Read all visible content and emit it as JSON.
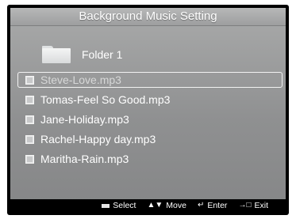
{
  "dialog": {
    "title": "Background Music Setting",
    "folder": {
      "label": "Folder 1",
      "icon": "folder-icon"
    },
    "files": [
      {
        "label": "Steve-Love.mp3",
        "checked": true,
        "selected": true
      },
      {
        "label": "Tomas-Feel So Good.mp3",
        "checked": true,
        "selected": false
      },
      {
        "label": "Jane-Holiday.mp3",
        "checked": true,
        "selected": false
      },
      {
        "label": "Rachel-Happy day.mp3",
        "checked": true,
        "selected": false
      },
      {
        "label": "Maritha-Rain.mp3",
        "checked": true,
        "selected": false
      }
    ]
  },
  "footer": {
    "select": {
      "label": "Select",
      "icon": "select-key-icon"
    },
    "move": {
      "label": "Move",
      "icon": "up-down-arrow-icon"
    },
    "enter": {
      "label": "Enter",
      "icon": "enter-icon"
    },
    "exit": {
      "label": "Exit",
      "icon": "exit-icon"
    }
  }
}
